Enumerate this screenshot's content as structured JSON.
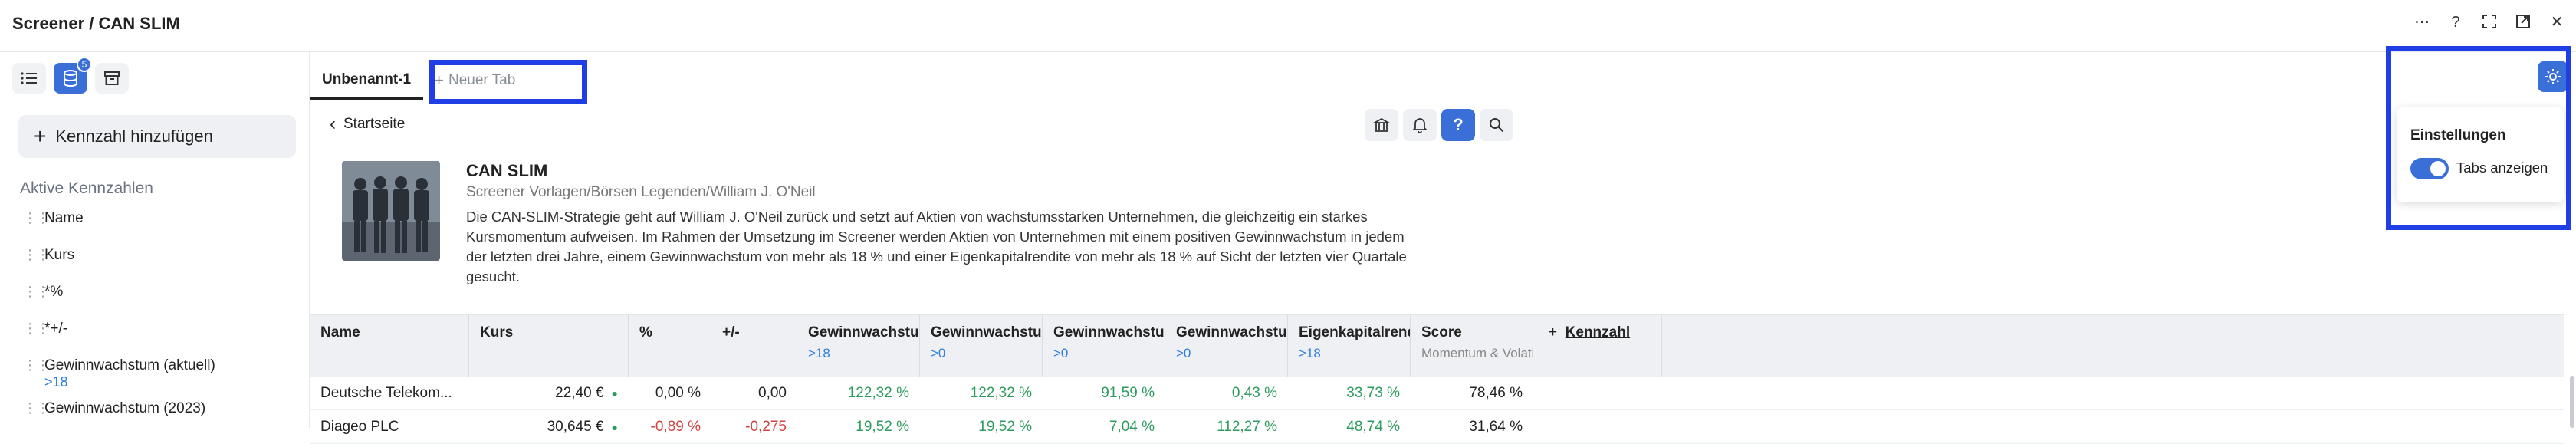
{
  "window": {
    "title": "Screener / CAN SLIM"
  },
  "sidebar": {
    "notification_count": "5",
    "add_button_label": "Kennzahl hinzufügen",
    "section_title": "Aktive Kennzahlen",
    "metrics": [
      {
        "label": "Name",
        "sub": ""
      },
      {
        "label": "Kurs",
        "sub": ""
      },
      {
        "label": "*%",
        "sub": ""
      },
      {
        "label": "*+/-",
        "sub": ""
      },
      {
        "label": "Gewinnwachstum (aktuell)",
        "sub": ">18"
      },
      {
        "label": "Gewinnwachstum (2023)",
        "sub": ""
      }
    ]
  },
  "tabs": {
    "active_label": "Unbenannt-1",
    "new_tab_label": "Neuer Tab"
  },
  "content": {
    "back_label": "Startseite",
    "title": "CAN SLIM",
    "breadcrumb": "Screener Vorlagen/Börsen Legenden/William J. O'Neil",
    "description": "Die CAN-SLIM-Strategie geht auf William J. O'Neil zurück und setzt auf Aktien von wachstumsstarken Unternehmen, die gleichzeitig ein starkes Kursmomentum aufweisen. Im Rahmen der Umsetzung im Screener werden Aktien von Unternehmen mit einem positiven Gewinnwachstum in jedem der letzten drei Jahre, einem Gewinnwachstum von mehr als 18 % und einer Eigenkapitalrendite von mehr als 18 % auf Sicht der letzten vier Quartale gesucht.",
    "help_label": "?"
  },
  "table": {
    "columns": [
      {
        "label": "Name",
        "sub": ""
      },
      {
        "label": "Kurs",
        "sub": ""
      },
      {
        "label": "%",
        "sub": ""
      },
      {
        "label": "+/-",
        "sub": ""
      },
      {
        "label": "Gewinnwachstum",
        "sub": ">18"
      },
      {
        "label": "Gewinnwachstum",
        "sub": ">0"
      },
      {
        "label": "Gewinnwachstum",
        "sub": ">0"
      },
      {
        "label": "Gewinnwachstum",
        "sub": ">0"
      },
      {
        "label": "Eigenkapitalrendite",
        "sub": ">18"
      },
      {
        "label": "Score",
        "sub": "Momentum & Volatilität"
      }
    ],
    "add_column_label": "Kennzahl",
    "rows": [
      {
        "name": "Deutsche Telekom...",
        "kurs": "22,40 €",
        "pct": "0,00 %",
        "chg": "0,00",
        "g1": "122,32 %",
        "g2": "122,32 %",
        "g3": "91,59 %",
        "g4": "0,43 %",
        "ek": "33,73 %",
        "score": "78,46 %"
      },
      {
        "name": "Diageo PLC",
        "kurs": "30,645 €",
        "pct": "-0,89 %",
        "chg": "-0,275",
        "g1": "19,52 %",
        "g2": "19,52 %",
        "g3": "7,04 %",
        "g4": "112,27 %",
        "ek": "48,74 %",
        "score": "31,64 %"
      }
    ]
  },
  "settings": {
    "title": "Einstellungen",
    "toggle_label": "Tabs anzeigen",
    "toggle_on": true
  },
  "colors": {
    "accent": "#3a6fd8",
    "highlight": "#1f3ee6",
    "positive": "#2e9b5e",
    "negative": "#d14343"
  }
}
